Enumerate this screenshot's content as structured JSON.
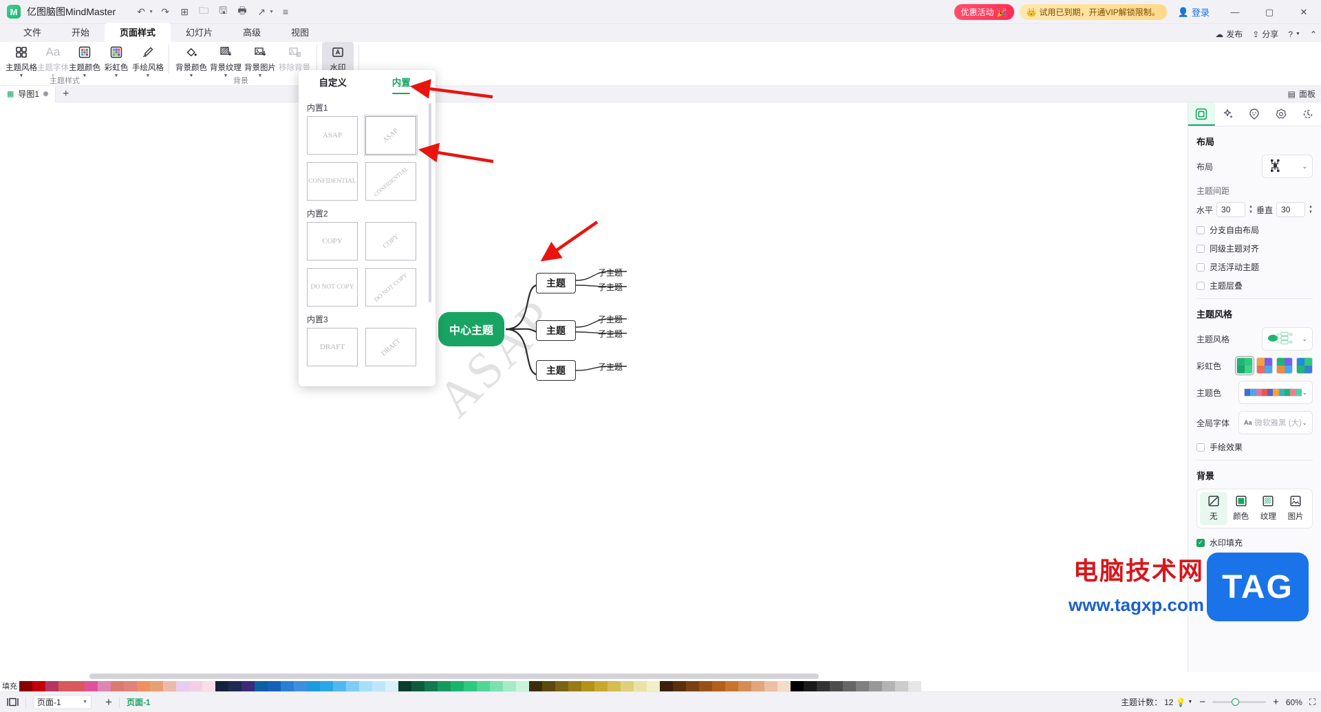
{
  "titlebar": {
    "app_name": "亿图脑图MindMaster",
    "logo_glyph": "M",
    "quick_tools": [
      {
        "name": "undo-button",
        "glyph": "↶",
        "caret": true
      },
      {
        "name": "redo-button",
        "glyph": "↷",
        "caret": false
      },
      {
        "name": "new-button",
        "glyph": "⊞",
        "caret": false
      },
      {
        "name": "open-button",
        "glyph": "🗀",
        "caret": false
      },
      {
        "name": "save-button",
        "glyph": "🖫",
        "caret": false
      },
      {
        "name": "print-button",
        "glyph": "🖶",
        "caret": false
      },
      {
        "name": "export-button",
        "glyph": "↗",
        "caret": true
      },
      {
        "name": "more-tools-button",
        "glyph": "≡",
        "caret": false
      }
    ],
    "promo_sale": "优惠活动",
    "promo_vip": "试用已到期，开通VIP解锁限制。",
    "login_label": "登录",
    "window_buttons": [
      "—",
      "▢",
      "✕"
    ]
  },
  "menu": {
    "tabs": [
      {
        "label": "文件",
        "active": false
      },
      {
        "label": "开始",
        "active": false
      },
      {
        "label": "页面样式",
        "active": true
      },
      {
        "label": "幻灯片",
        "active": false
      },
      {
        "label": "高级",
        "active": false
      },
      {
        "label": "视图",
        "active": false
      }
    ],
    "right_items": [
      {
        "name": "publish-button",
        "glyph": "☁",
        "label": "发布"
      },
      {
        "name": "share-button",
        "glyph": "⇪",
        "label": "分享"
      },
      {
        "name": "help-button",
        "glyph": "?",
        "label": ""
      },
      {
        "name": "collapse-ribbon-button",
        "glyph": "⌃",
        "label": ""
      }
    ]
  },
  "ribbon": {
    "groups": [
      {
        "name": "主题样式",
        "buttons": [
          {
            "label": "主题风格",
            "icon": "grid-icon",
            "caret": true,
            "disabled": false,
            "selected": false
          },
          {
            "label": "主题字体",
            "icon": "font-icon",
            "caret": true,
            "disabled": true,
            "selected": false
          },
          {
            "label": "主题颜色",
            "icon": "palette-icon",
            "caret": true,
            "disabled": false,
            "selected": false
          },
          {
            "label": "彩虹色",
            "icon": "rainbow-icon",
            "caret": true,
            "disabled": false,
            "selected": false
          },
          {
            "label": "手绘风格",
            "icon": "pen-icon",
            "caret": true,
            "disabled": false,
            "selected": false
          }
        ]
      },
      {
        "name": "背景",
        "buttons": [
          {
            "label": "背景颜色",
            "icon": "fill-bucket-icon",
            "caret": true,
            "disabled": false,
            "selected": false
          },
          {
            "label": "背景纹理",
            "icon": "texture-icon",
            "caret": true,
            "disabled": false,
            "selected": false
          },
          {
            "label": "背景图片",
            "icon": "image-download-icon",
            "caret": true,
            "disabled": false,
            "selected": false
          },
          {
            "label": "移除背景",
            "icon": "image-remove-icon",
            "caret": false,
            "disabled": true,
            "selected": false
          }
        ]
      },
      {
        "name": "",
        "buttons": [
          {
            "label": "水印",
            "icon": "watermark-icon",
            "caret": true,
            "disabled": false,
            "selected": true
          }
        ]
      }
    ]
  },
  "doc_tabs": {
    "tabs": [
      {
        "label": "导图1",
        "modified": true
      }
    ],
    "add_label": "+",
    "panel_toggle": "面板"
  },
  "watermark_panel": {
    "tabs": [
      {
        "label": "自定义",
        "active": false
      },
      {
        "label": "内置",
        "active": true
      }
    ],
    "sections": [
      {
        "title": "内置1",
        "items": [
          {
            "text": "ASAP",
            "rotated": false,
            "selected": false
          },
          {
            "text": "ASAP",
            "rotated": true,
            "selected": true
          },
          {
            "text": "CONFIDENTIAL",
            "rotated": false,
            "selected": false
          },
          {
            "text": "CONFIDENTIAL",
            "rotated": true,
            "selected": false
          }
        ]
      },
      {
        "title": "内置2",
        "items": [
          {
            "text": "COPY",
            "rotated": false,
            "selected": false
          },
          {
            "text": "COPY",
            "rotated": true,
            "selected": false
          },
          {
            "text": "DO NOT COPY",
            "rotated": false,
            "selected": false
          },
          {
            "text": "DO NOT COPY",
            "rotated": true,
            "selected": false
          }
        ]
      },
      {
        "title": "内置3",
        "items": [
          {
            "text": "DRAFT",
            "rotated": false,
            "selected": false
          },
          {
            "text": "DRAFT",
            "rotated": true,
            "selected": false
          }
        ]
      }
    ]
  },
  "canvas": {
    "watermark_text": "ASAP",
    "central_topic": "中心主题",
    "topics": [
      "主题",
      "主题",
      "主题"
    ],
    "subtopics": [
      "子主题",
      "子主题",
      "子主题",
      "子主题",
      "子主题"
    ]
  },
  "right_panel": {
    "tabs": [
      {
        "name": "layout-tab",
        "glyph": "▣",
        "active": true
      },
      {
        "name": "ai-sparkle-tab",
        "glyph": "✦",
        "active": false
      },
      {
        "name": "emoji-tab",
        "glyph": "☺",
        "active": false
      },
      {
        "name": "settings-gear-tab",
        "glyph": "⚙",
        "active": false
      },
      {
        "name": "history-clock-tab",
        "glyph": "◔",
        "active": false
      }
    ],
    "layout": {
      "heading": "布局",
      "layout_label": "布局",
      "spacing_heading": "主题间距",
      "horizontal_label": "水平",
      "horizontal_value": "30",
      "vertical_label": "垂直",
      "vertical_value": "30",
      "checkboxes": [
        {
          "label": "分支自由布局",
          "checked": false
        },
        {
          "label": "同级主题对齐",
          "checked": false
        },
        {
          "label": "灵活浮动主题",
          "checked": false
        },
        {
          "label": "主题层叠",
          "checked": false
        }
      ]
    },
    "theme_style": {
      "heading": "主题风格",
      "style_label": "主题风格",
      "rainbow_label": "彩虹色",
      "rainbow_swatches": [
        {
          "colors": [
            "#1fb673",
            "#2ec97f",
            "#1aa868",
            "#3ad48c"
          ],
          "selected": true
        },
        {
          "colors": [
            "#f2a33c",
            "#7b5cf0",
            "#ef6b5a",
            "#4aa8e8"
          ],
          "selected": false
        },
        {
          "colors": [
            "#1fb673",
            "#7b5cf0",
            "#ef8b3c",
            "#4aa8e8"
          ],
          "selected": false
        },
        {
          "colors": [
            "#1f8fd6",
            "#2ec97f",
            "#1fb673",
            "#3a7fd5"
          ],
          "selected": false
        }
      ],
      "theme_color_label": "主题色",
      "theme_colors": [
        "#3b6fd4",
        "#4aa8e8",
        "#e86fa0",
        "#ef5350",
        "#5c5fc4",
        "#f2a33c",
        "#3ab0c4",
        "#1fb673",
        "#ef7f8e",
        "#4fd1a5"
      ],
      "global_font_label": "全局字体",
      "global_font_value": "微软雅黑 (大)",
      "handdrawn_label": "手绘效果",
      "handdrawn_checked": false
    },
    "background": {
      "heading": "背景",
      "options": [
        {
          "label": "无",
          "icon": "none-icon",
          "active": true
        },
        {
          "label": "颜色",
          "icon": "color-icon",
          "active": false
        },
        {
          "label": "纹理",
          "icon": "texture-icon",
          "active": false
        },
        {
          "label": "图片",
          "icon": "image-icon",
          "active": false
        }
      ],
      "watermark_fill_label": "水印填充",
      "watermark_fill_checked": true
    }
  },
  "statusbar": {
    "fill_label": "填充",
    "view_icon": "page-view-icon",
    "page_select_value": "页面-1",
    "add_page_label": "+",
    "current_page": "页面-1",
    "topic_count_label": "主题计数：",
    "topic_count_value": "12",
    "zoom_value": "60%"
  },
  "branding": {
    "cn_text": "电脑技术网",
    "url_text": "www.tagxp.com",
    "tag_text": "TAG"
  },
  "colors": {
    "accent_green": "#19a463",
    "link_blue": "#1a73e8",
    "ribbon_bg": "#ffffff",
    "chrome_bg": "#f2f2f6",
    "annotation_red": "#e8150f"
  },
  "fill_palette": [
    "#8b0000",
    "#c4000b",
    "#b5375f",
    "#d85a5a",
    "#d9585c",
    "#e0519c",
    "#dd86b3",
    "#dd7a6f",
    "#df8477",
    "#f09060",
    "#e8a070",
    "#eeb9ad",
    "#e9cdf0",
    "#f4cfe4",
    "#fbdde8",
    "#16213e",
    "#1e2a52",
    "#3b2a7a",
    "#0b5fa4",
    "#1462b8",
    "#2a7fd4",
    "#3f8fe0",
    "#1c9be0",
    "#2aa7e8",
    "#4fb9ef",
    "#7fcdf5",
    "#a8dff8",
    "#bfe7fb",
    "#d8f1fd",
    "#0b3d2e",
    "#0e5a3d",
    "#127a4e",
    "#16995f",
    "#1ab36d",
    "#2ec97f",
    "#52d694",
    "#7de0ae",
    "#a6ebc8",
    "#c8f3dd",
    "#3d2e0b",
    "#5a4a0e",
    "#7a6312",
    "#997c16",
    "#b3921a",
    "#c9a72e",
    "#d6bd52",
    "#e0d07d",
    "#ebe2a6",
    "#f3eec8",
    "#3d1f0b",
    "#5a2f0e",
    "#7a4012",
    "#995016",
    "#b3601a",
    "#c9742e",
    "#d68c52",
    "#e0a57d",
    "#ebc0a6",
    "#f3dcc8",
    "#000000",
    "#1a1a1a",
    "#333333",
    "#4d4d4d",
    "#666666",
    "#808080",
    "#999999",
    "#b3b3b3",
    "#cccccc",
    "#e6e6e6"
  ]
}
